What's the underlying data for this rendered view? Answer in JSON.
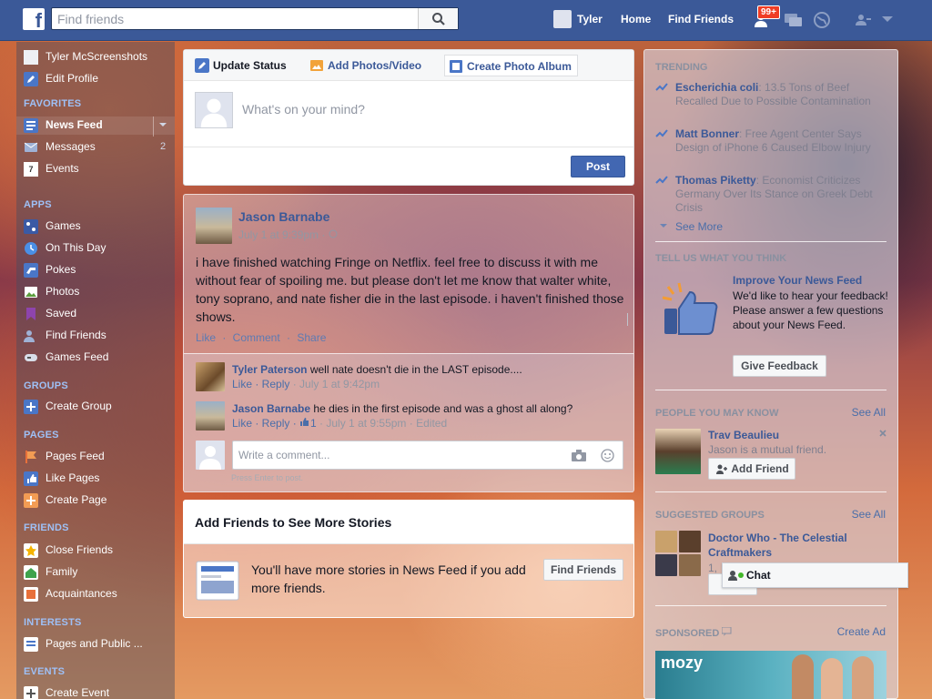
{
  "topbar": {
    "search_placeholder": "Find friends",
    "user_name": "Tyler",
    "home": "Home",
    "find_friends": "Find Friends",
    "notif_badge": "99+"
  },
  "leftnav": {
    "profile_name": "Tyler McScreenshots",
    "edit_profile": "Edit Profile",
    "favorites_head": "FAVORITES",
    "favorites": [
      {
        "label": "News Feed",
        "count": ""
      },
      {
        "label": "Messages",
        "count": "2"
      },
      {
        "label": "Events",
        "count": ""
      }
    ],
    "events_icon_text": "7",
    "apps_head": "APPS",
    "apps": [
      "Games",
      "On This Day",
      "Pokes",
      "Photos",
      "Saved",
      "Find Friends",
      "Games Feed"
    ],
    "groups_head": "GROUPS",
    "groups": [
      "Create Group"
    ],
    "pages_head": "PAGES",
    "pages": [
      "Pages Feed",
      "Like Pages",
      "Create Page"
    ],
    "friends_head": "FRIENDS",
    "friends": [
      "Close Friends",
      "Family",
      "Acquaintances"
    ],
    "interests_head": "INTERESTS",
    "interests": [
      "Pages and Public ..."
    ],
    "events_head": "EVENTS",
    "events": [
      "Create Event"
    ]
  },
  "composer": {
    "tab_status": "Update Status",
    "tab_photos": "Add Photos/Video",
    "tab_album": "Create Photo Album",
    "placeholder": "What's on your mind?",
    "post": "Post"
  },
  "story": {
    "actor": "Jason Barnabe",
    "timestamp": "July 1 at 9:39pm · ",
    "text": "i have finished watching Fringe on Netflix. feel free to discuss it with me without fear of spoiling me. but please don't let me know that walter white, tony soprano, and nate fisher die in the last episode. i haven't finished those shows.",
    "actions": "Like · Comment · Share",
    "comments": [
      {
        "name": "Tyler Paterson",
        "text": "well nate doesn't die in the LAST episode....",
        "meta_actions": "Like · Reply",
        "meta_time": " · July 1 at 9:42pm",
        "likes": ""
      },
      {
        "name": "Jason Barnabe",
        "text": "he dies in the first episode and was a ghost all along?",
        "meta_actions": "Like · Reply · ",
        "meta_time": " · July 1 at 9:55pm · Edited",
        "likes": "1"
      }
    ],
    "comment_placeholder": "Write a comment...",
    "press_enter": "Press Enter to post."
  },
  "addfriends": {
    "title": "Add Friends to See More Stories",
    "text": "You'll have more stories in News Feed if you add more friends.",
    "button": "Find Friends"
  },
  "rightrail": {
    "trending_head": "TRENDING",
    "trending": [
      {
        "topic": "Escherichia coli",
        "desc": ": 13.5 Tons of Beef Recalled Due to Possible Contamination"
      },
      {
        "topic": "Matt Bonner",
        "desc": ": Free Agent Center Says Design of iPhone 6 Caused Elbow Injury"
      },
      {
        "topic": "Thomas Piketty",
        "desc": ": Economist Criticizes Germany Over Its Stance on Greek Debt Crisis"
      }
    ],
    "see_more": "See More",
    "feedback_head": "TELL US WHAT YOU THINK",
    "feedback_title": "Improve Your News Feed",
    "feedback_text": "We'd like to hear your feedback! Please answer a few questions about your News Feed.",
    "feedback_button": "Give Feedback",
    "pymk_head": "PEOPLE YOU MAY KNOW",
    "pymk_see_all": "See All",
    "pymk_name": "Trav Beaulieu",
    "pymk_sub": "Jason is a mutual friend.",
    "pymk_button": "Add Friend",
    "groups_head": "SUGGESTED GROUPS",
    "groups_see_all": "See All",
    "group_name": "Doctor Who - The Celestial Craftmakers",
    "group_sub": "1,",
    "group_button": "Join",
    "sponsored_head": "SPONSORED",
    "create_ad": "Create Ad",
    "ad_brand": "mozy"
  },
  "chat": {
    "label": "Chat"
  }
}
